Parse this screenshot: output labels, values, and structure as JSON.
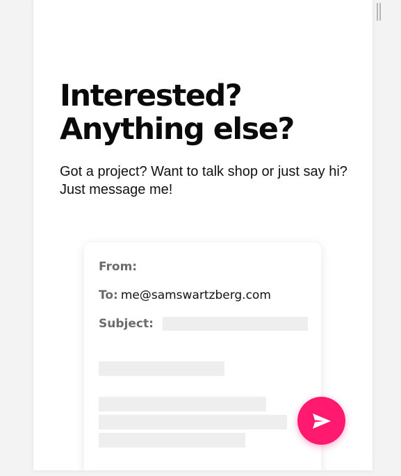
{
  "hero": {
    "headline_line1": "Interested?",
    "headline_line2": "Anything else?",
    "subtext": "Got a project? Want to talk shop or just say hi? Just message me!"
  },
  "email": {
    "from_label": "From:",
    "to_label": "To:",
    "to_value": "me@samswartzberg.com",
    "subject_label": "Subject:"
  },
  "send_button": {
    "icon": "send-icon",
    "color": "#ff1a6f"
  }
}
